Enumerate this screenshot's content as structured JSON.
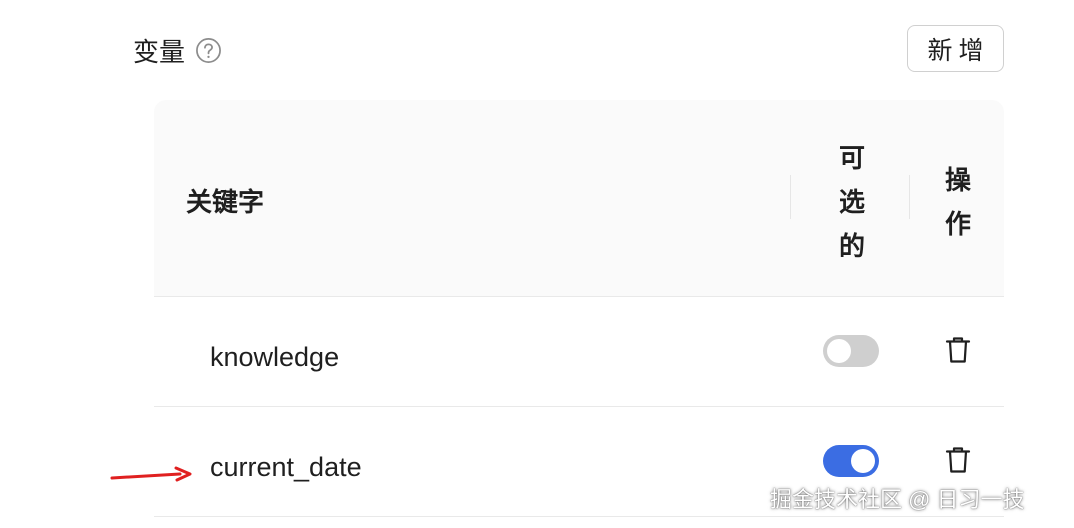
{
  "header": {
    "title": "变量",
    "help_icon": "question-circle-icon",
    "add_button_label": "新增"
  },
  "table": {
    "columns": {
      "keyword": "关键字",
      "optional": "可选的",
      "actions": "操作"
    },
    "rows": [
      {
        "keyword": "knowledge",
        "optional": false,
        "delete_icon": "trash-icon"
      },
      {
        "keyword": "current_date",
        "optional": true,
        "delete_icon": "trash-icon"
      }
    ]
  },
  "annotation": {
    "arrow_color": "#e02020"
  },
  "colors": {
    "toggle_on": "#3b6de3",
    "toggle_off": "#cfcfcf"
  },
  "watermark": "掘金技术社区 @ 日习一技"
}
